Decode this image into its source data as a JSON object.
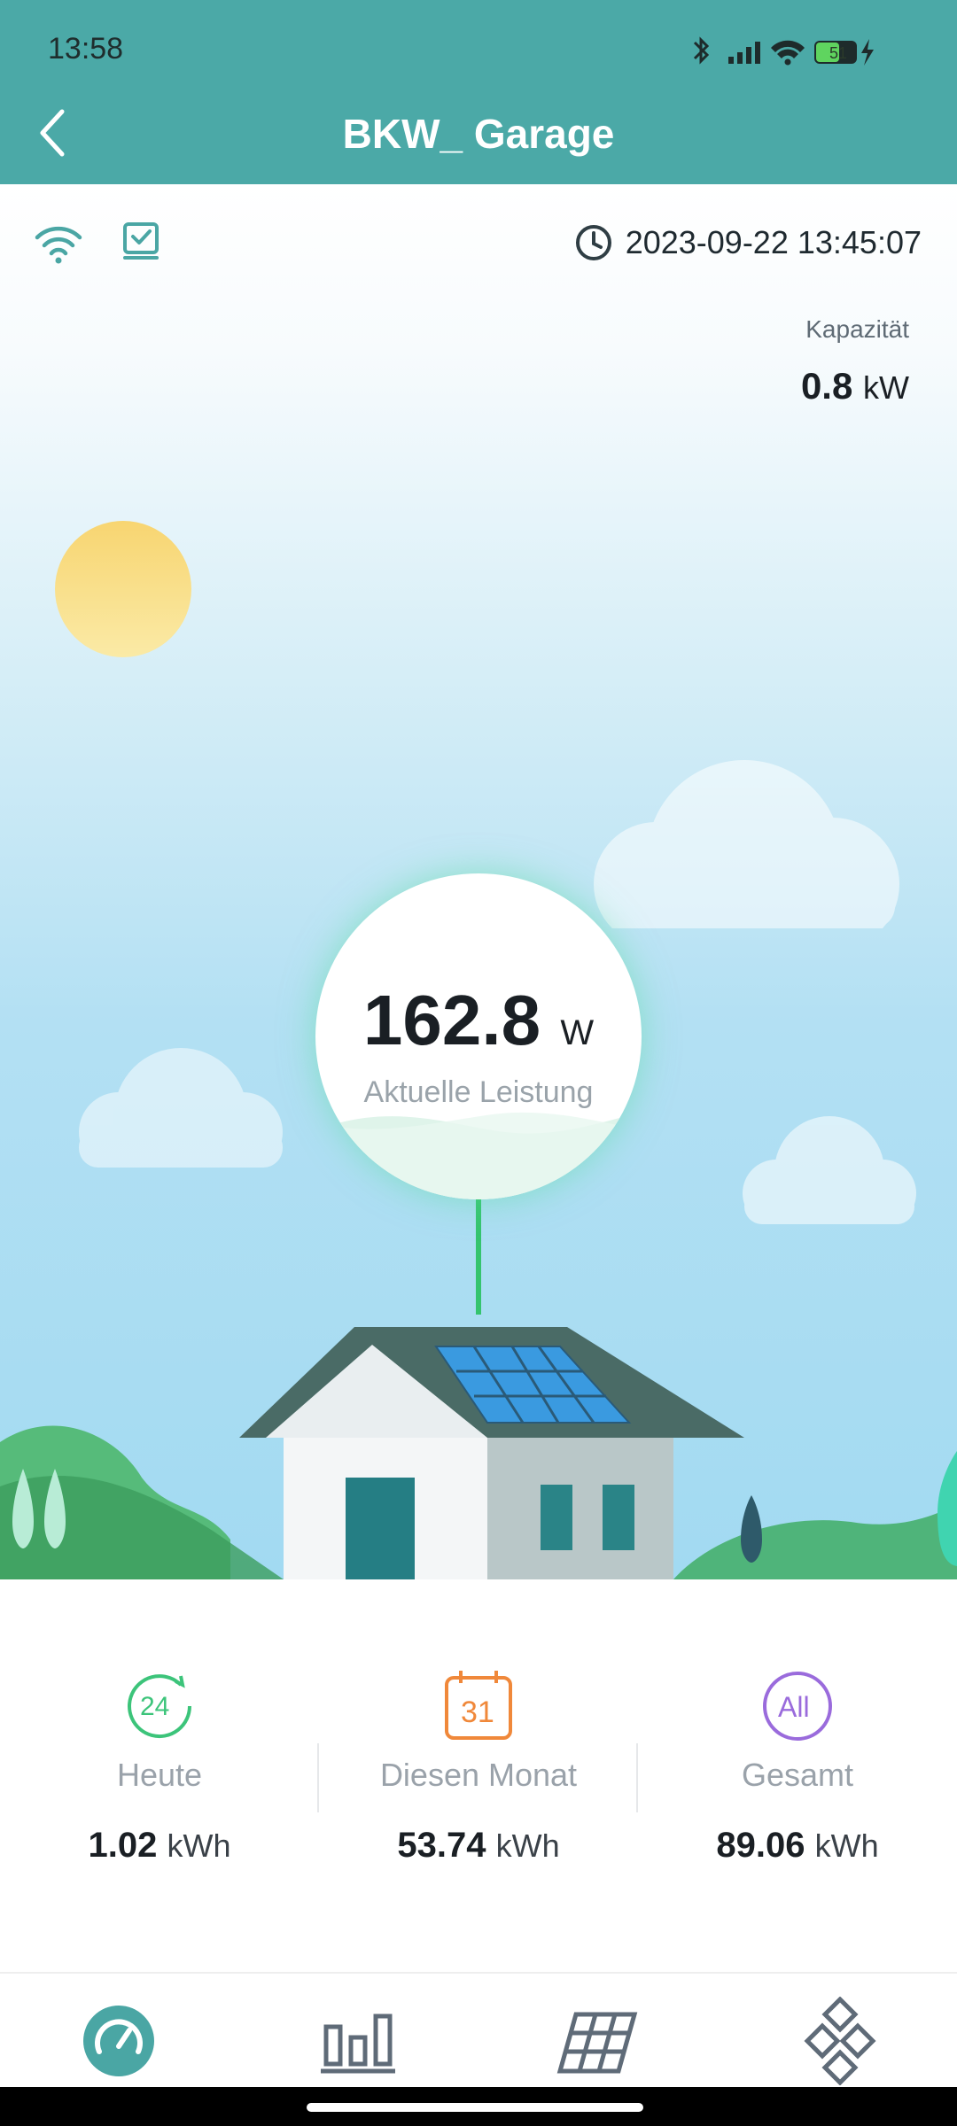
{
  "status_bar": {
    "time": "13:58",
    "battery_level": "51"
  },
  "header": {
    "title": "BKW_ Garage"
  },
  "device": {
    "timestamp": "2023-09-22 13:45:07"
  },
  "capacity": {
    "label": "Kapazität",
    "value": "0.8",
    "unit": "kW"
  },
  "power": {
    "value": "162.8",
    "unit": "W",
    "label": "Aktuelle Leistung"
  },
  "stats": [
    {
      "label": "Heute",
      "value": "1.02",
      "unit": "kWh",
      "icon": "24h-icon",
      "icon_text": "24",
      "color": "#3cc47a"
    },
    {
      "label": "Diesen Monat",
      "value": "53.74",
      "unit": "kWh",
      "icon": "calendar-icon",
      "icon_text": "31",
      "color": "#f0883a"
    },
    {
      "label": "Gesamt",
      "value": "89.06",
      "unit": "kWh",
      "icon": "all-icon",
      "icon_text": "All",
      "color": "#9a6bdc"
    }
  ],
  "nav": [
    {
      "name": "dashboard-tab",
      "icon": "gauge-icon",
      "active": true
    },
    {
      "name": "statistics-tab",
      "icon": "bar-chart-icon",
      "active": false
    },
    {
      "name": "panels-tab",
      "icon": "solar-panel-icon",
      "active": false
    },
    {
      "name": "more-tab",
      "icon": "grid-diamond-icon",
      "active": false
    }
  ],
  "colors": {
    "accent": "#4ba9a7",
    "power_line": "#35c46e"
  }
}
